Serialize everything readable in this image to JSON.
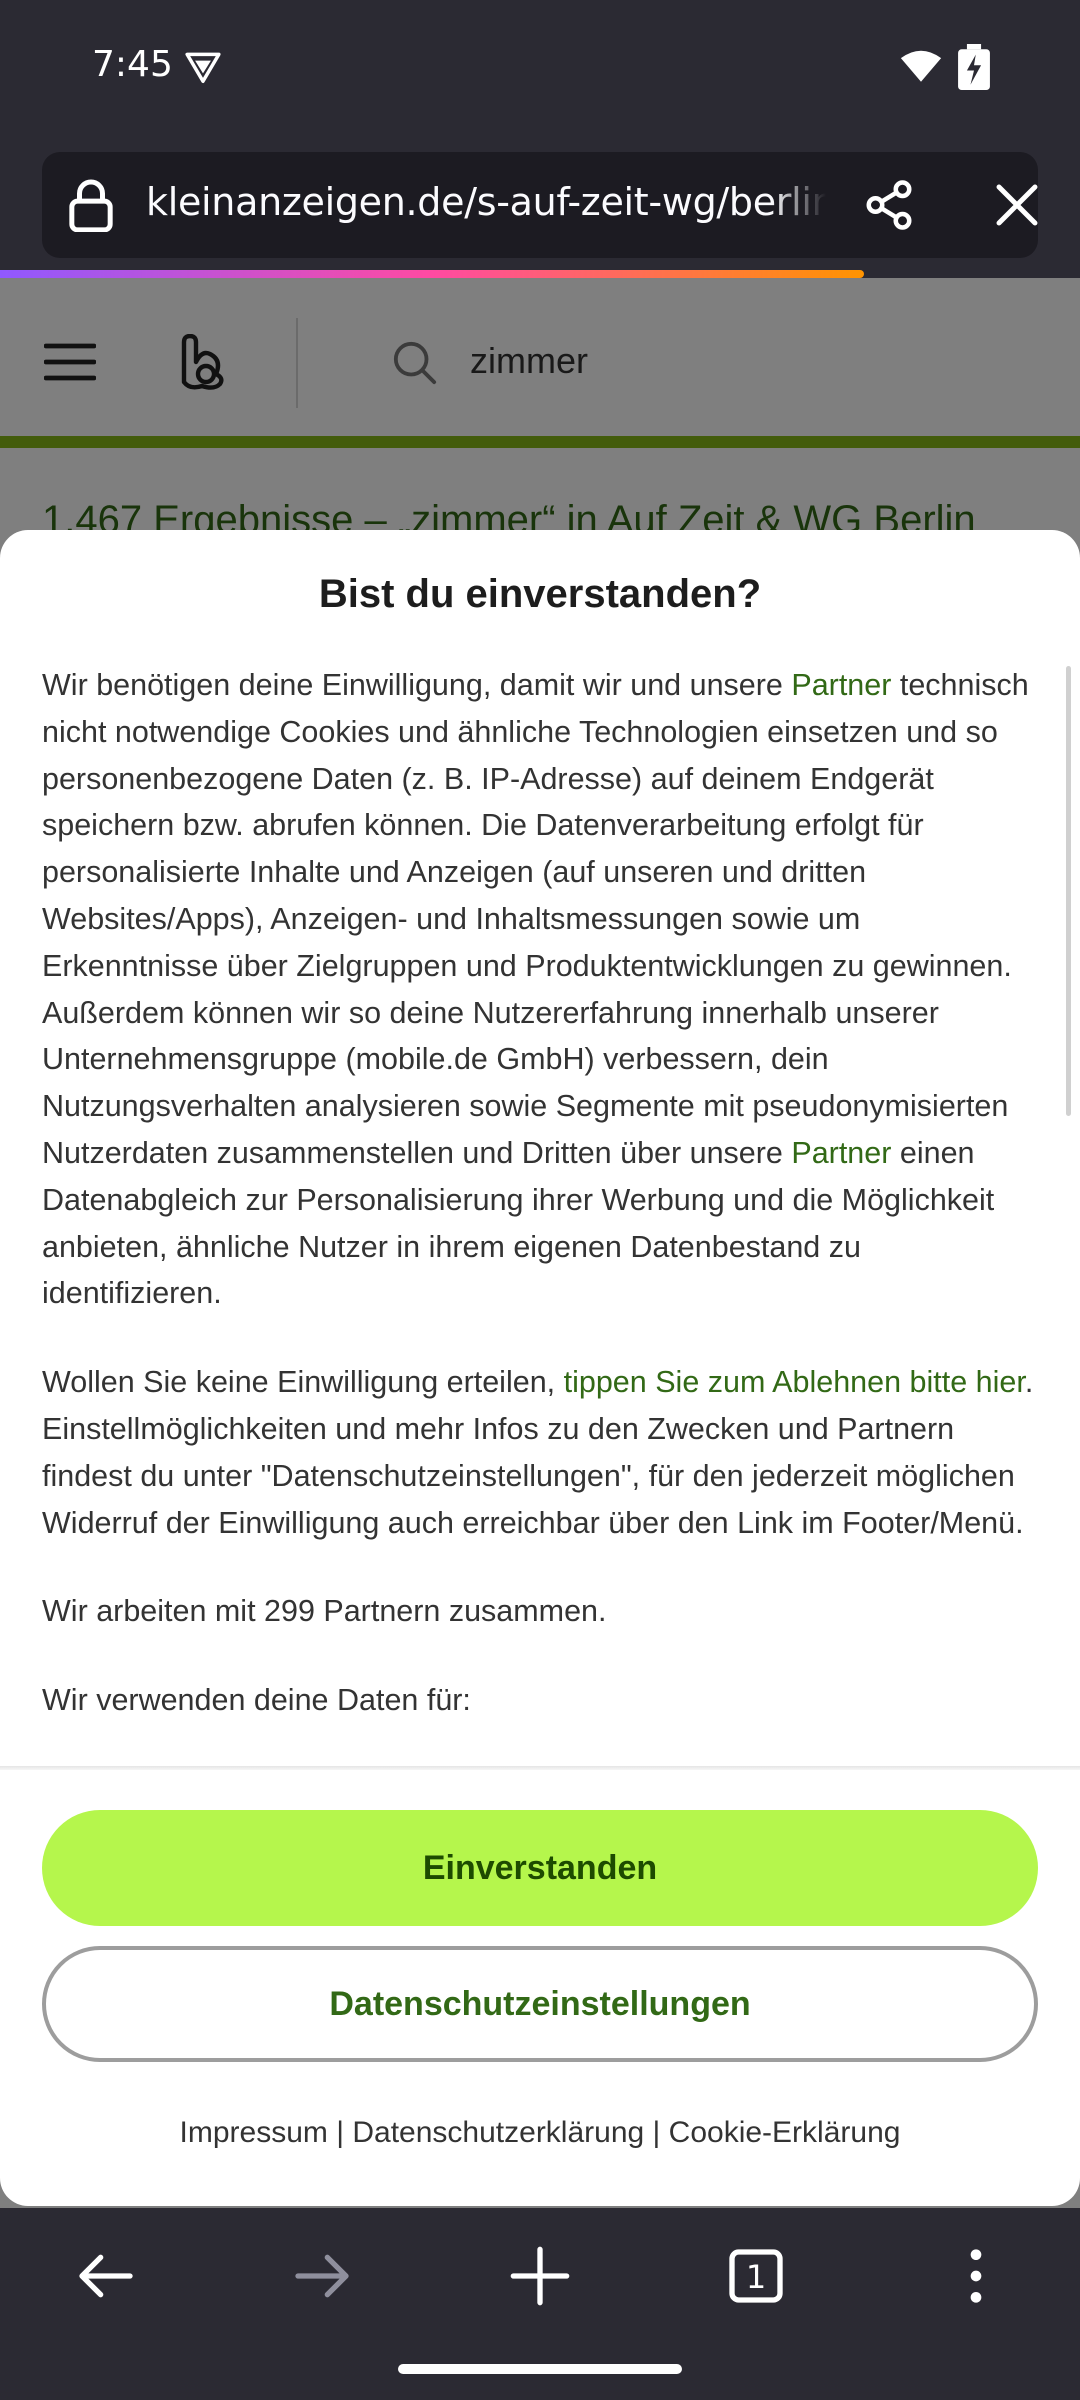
{
  "status_bar": {
    "time": "7:45"
  },
  "url_bar": {
    "url": "kleinanzeigen.de/s-auf-zeit-wg/berlin"
  },
  "page": {
    "search_query": "zimmer",
    "results_text": "1.467 Ergebnisse – „zimmer“ in Auf Zeit & WG Berlin"
  },
  "consent": {
    "title": "Bist du einverstanden?",
    "p1": {
      "part1": "Wir benötigen deine Einwilligung, damit wir und unsere ",
      "partner_link1": "Partner",
      "part2": " technisch nicht notwendige Cookies und ähnliche Technologien einsetzen und so personenbezogene Daten (z. B. IP-Adresse) auf deinem Endgerät speichern bzw. abrufen können. Die Datenverarbeitung erfolgt für personalisierte Inhalte und Anzeigen (auf unseren und dritten Websites/Apps), Anzeigen- und Inhaltsmessungen sowie um Erkenntnisse über Zielgruppen und Produktentwicklungen zu gewinnen. Außerdem können wir so deine Nutzererfahrung innerhalb unserer Unternehmensgruppe (mobile.de GmbH) verbessern, dein Nutzungsverhalten analysieren sowie Segmente mit pseudonymisierten Nutzerdaten zusammenstellen und Dritten über unsere ",
      "partner_link2": "Partner",
      "part3": " einen Datenabgleich zur Personalisierung ihrer Werbung und die Möglichkeit anbieten, ähnliche Nutzer in ihrem eigenen Datenbestand zu identifizieren."
    },
    "p2": {
      "part1": "Wollen Sie keine Einwilligung erteilen, ",
      "decline_link": "tippen Sie zum Ablehnen bitte hier",
      "part2": ". Einstellmöglichkeiten und mehr Infos zu den Zwecken und Partnern findest du unter \"Datenschutzeinstellungen\", für den jederzeit möglichen Widerruf der Einwilligung auch erreichbar über den Link im Footer/Menü."
    },
    "p3": "Wir arbeiten mit 299 Partnern zusammen.",
    "p4": "Wir verwenden deine Daten für:",
    "accept_label": "Einverstanden",
    "settings_label": "Datenschutzeinstellungen",
    "footer": {
      "impressum": "Impressum",
      "sep": " | ",
      "privacy": "Datenschutzerklärung",
      "cookie": "Cookie-Erklärung"
    }
  },
  "toolbar": {
    "tab_count": "1"
  },
  "colors": {
    "accent_green": "#b5f64c",
    "link_green": "#326916",
    "chrome_dark": "#2b2a33"
  }
}
